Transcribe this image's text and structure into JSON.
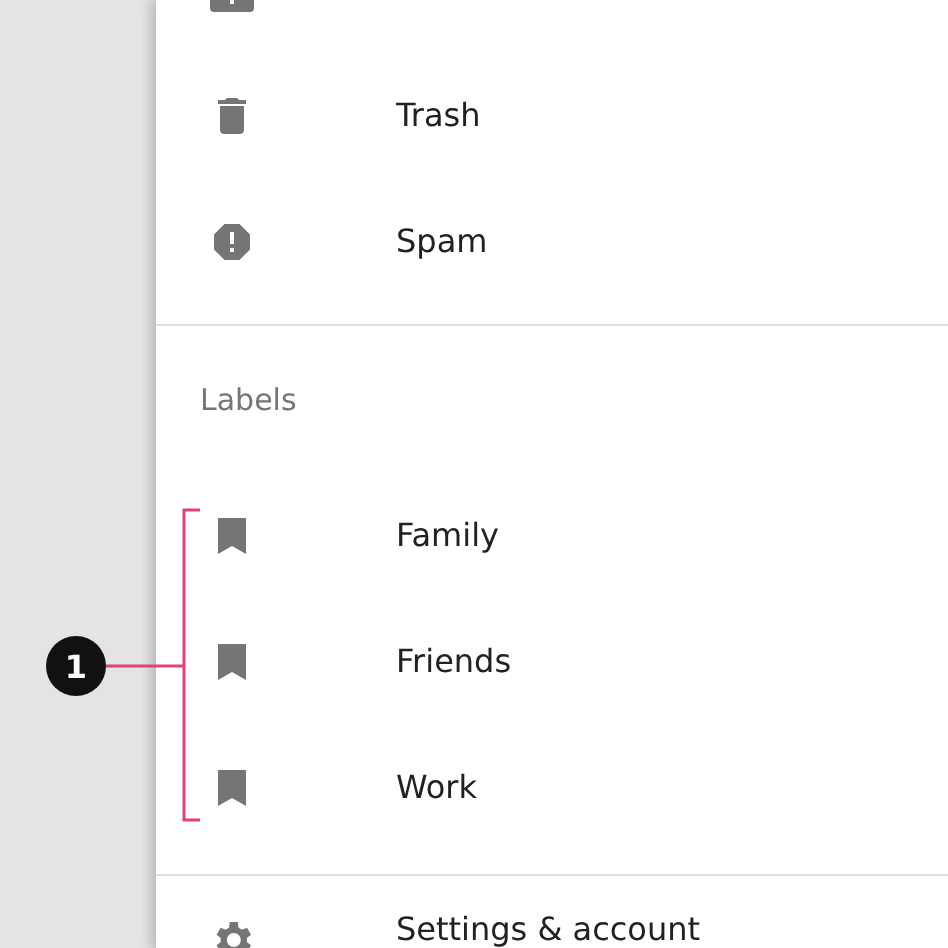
{
  "menu_items": [
    {
      "kind": "trash",
      "label": "Trash"
    },
    {
      "kind": "spam",
      "label": "Spam"
    }
  ],
  "labels_section": {
    "header": "Labels",
    "items": [
      {
        "kind": "label",
        "label": "Family"
      },
      {
        "kind": "label",
        "label": "Friends"
      },
      {
        "kind": "label",
        "label": "Work"
      }
    ]
  },
  "footer_items": [
    {
      "kind": "settings",
      "label": "Settings & account"
    }
  ],
  "callout": {
    "number": "1"
  }
}
